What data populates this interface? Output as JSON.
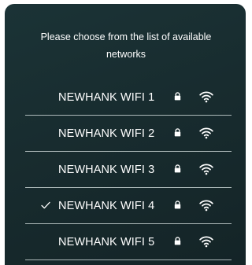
{
  "prompt": "Please choose from the list of available networks",
  "networks": [
    {
      "ssid": "NEWHANK WIFI 1",
      "selected": false,
      "secured": true,
      "signal_icon": "wifi-full-icon"
    },
    {
      "ssid": "NEWHANK WIFI 2",
      "selected": false,
      "secured": true,
      "signal_icon": "wifi-full-icon"
    },
    {
      "ssid": "NEWHANK WIFI 3",
      "selected": false,
      "secured": true,
      "signal_icon": "wifi-full-icon"
    },
    {
      "ssid": "NEWHANK WIFI 4",
      "selected": true,
      "secured": true,
      "signal_icon": "wifi-full-icon"
    },
    {
      "ssid": "NEWHANK WIFI 5",
      "selected": false,
      "secured": true,
      "signal_icon": "wifi-full-icon"
    }
  ],
  "colors": {
    "panel_background": "#182c2f",
    "text": "#ffffff",
    "divider": "#c9d3d4"
  }
}
